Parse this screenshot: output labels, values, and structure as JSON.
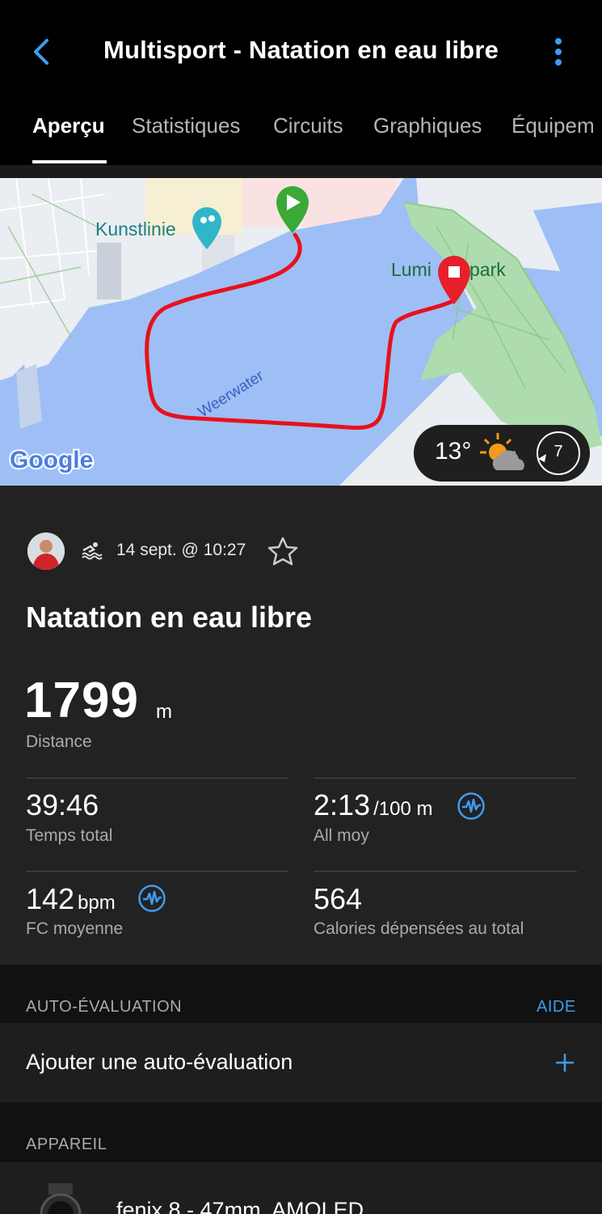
{
  "header": {
    "title": "Multisport - Natation en eau libre",
    "back_icon": "chevron-left-icon",
    "menu_icon": "kebab-menu-icon",
    "accent": "#3f9cf0"
  },
  "tabs": [
    {
      "label": "Aperçu",
      "active": true
    },
    {
      "label": "Statistiques"
    },
    {
      "label": "Circuits"
    },
    {
      "label": "Graphiques"
    },
    {
      "label": "Équipem"
    }
  ],
  "map": {
    "poi_label": "Kunstlinie",
    "park_label_left": "Lumi",
    "park_label_right": "park",
    "water_label": "Weerwater",
    "attribution": "Google",
    "start_icon": "play-marker-icon",
    "end_icon": "stop-marker-icon",
    "route_color": "#e8101c",
    "weather": {
      "temperature": "13°",
      "icon": "sun-cloud-icon",
      "wind": "7"
    }
  },
  "activity": {
    "date": "14 sept. @ 10:27",
    "title": "Natation en eau libre",
    "distance": {
      "value": "1799",
      "unit": "m",
      "label": "Distance"
    },
    "stats": [
      {
        "value": "39:46",
        "unit": "",
        "label": "Temps total"
      },
      {
        "value": "2:13",
        "unit": "/100 m",
        "label": "All moy"
      },
      {
        "value": "142",
        "unit": "bpm",
        "label": "FC moyenne"
      },
      {
        "value": "564",
        "unit": "",
        "label": "Calories dépensées au total"
      }
    ]
  },
  "self_eval": {
    "heading": "AUTO-ÉVALUATION",
    "help": "AIDE",
    "add_label": "Ajouter une auto-évaluation"
  },
  "device": {
    "heading": "APPAREIL",
    "name": "fenix 8 - 47mm, AMOLED"
  }
}
